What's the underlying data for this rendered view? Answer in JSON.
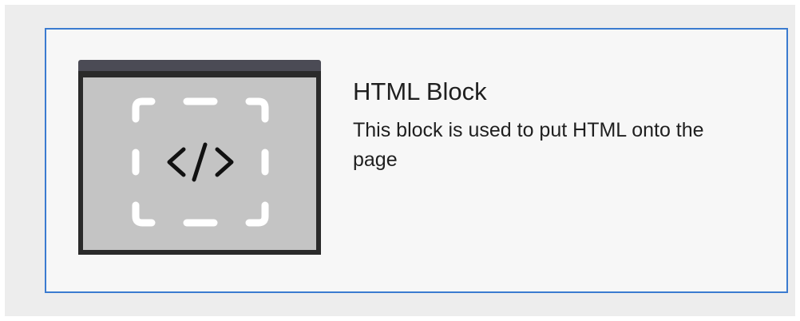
{
  "block": {
    "title": "HTML Block",
    "description": "This block is used to put HTML onto the page",
    "icon": "html-code-icon"
  },
  "colors": {
    "panel_background": "#ededed",
    "card_background": "#f7f7f7",
    "card_border": "#3b7bd0",
    "thumb_frame": "#2a2a2a",
    "thumb_titlebar": "#4b4b55",
    "thumb_fill": "#c4c4c4",
    "text": "#1f1f1f"
  }
}
